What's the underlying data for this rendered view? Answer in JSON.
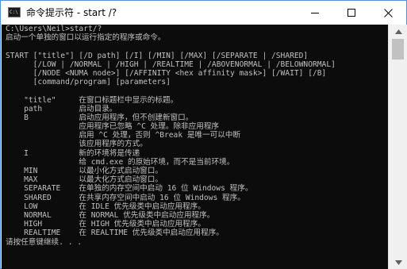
{
  "window": {
    "title": "命令提示符 - start /?",
    "icon_text": "C:\\"
  },
  "titlebar_buttons": {
    "minimize": "minimize-icon",
    "maximize": "maximize-icon",
    "close": "close-icon"
  },
  "console": {
    "lines": [
      "C:\\Users\\Neil>start/?",
      "启动一个单独的窗口以运行指定的程序或命令。",
      "",
      "START [\"title\"] [/D path] [/I] [/MIN] [/MAX] [/SEPARATE | /SHARED]",
      "      [/LOW | /NORMAL | /HIGH | /REALTIME | /ABOVENORMAL | /BELOWNORMAL]",
      "      [/NODE <NUMA node>] [/AFFINITY <hex affinity mask>] [/WAIT] [/B]",
      "      [command/program] [parameters]",
      "",
      "    \"title\"     在窗口标题栏中显示的标题。",
      "    path        启动目录。",
      "    B           启动应用程序，但不创建新窗口。",
      "                应用程序已忽略 ^C 处理。除非应用程序",
      "                启用 ^C 处理，否则 ^Break 是唯一可以中断",
      "                该应用程序的方式。",
      "    I           新的环境将是传递",
      "                给 cmd.exe 的原始环境，而不是当前环境。",
      "    MIN         以最小化方式启动窗口。",
      "    MAX         以最大化方式启动窗口。",
      "    SEPARATE    在单独的内存空间中启动 16 位 Windows 程序。",
      "    SHARED      在共享内存空间中启动 16 位 Windows 程序。",
      "    LOW         在 IDLE 优先级类中启动应用程序。",
      "    NORMAL      在 NORMAL 优先级类中启动应用程序。",
      "    HIGH        在 HIGH 优先级类中启动应用程序。",
      "    REALTIME    在 REALTIME 优先级类中启动应用程序。",
      "请按任意键继续. . ."
    ]
  },
  "scrollbar": {
    "up_icon": "scroll-up-arrow-icon",
    "down_icon": "scroll-down-arrow-icon"
  },
  "colors": {
    "console_bg": "#0c0c0c",
    "console_fg": "#c0c0c0",
    "window_border": "#5a8fcf"
  }
}
